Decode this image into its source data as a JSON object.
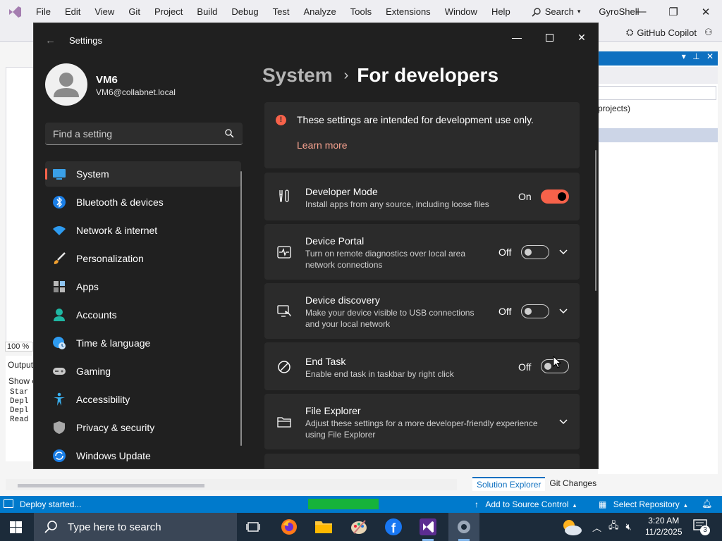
{
  "vs": {
    "menu": [
      "File",
      "Edit",
      "View",
      "Git",
      "Project",
      "Build",
      "Debug",
      "Test",
      "Analyze",
      "Tools",
      "Extensions",
      "Window",
      "Help"
    ],
    "search_label": "Search",
    "solution_name": "GyroShell",
    "copilot_label": "GitHub Copilot",
    "zoom": "100 %",
    "output_title": "Output",
    "output_show": "Show o",
    "output_lines": [
      "Star",
      "Depl",
      "Depl",
      "Read"
    ],
    "se_projects_text": "projects)",
    "tabs": [
      "Solution Explorer",
      "Git Changes"
    ],
    "status": {
      "text": "Deploy started...",
      "source_control": "Add to Source Control",
      "repository": "Select Repository"
    }
  },
  "taskbar": {
    "search_placeholder": "Type here to search",
    "time": "3:20 AM",
    "date": "11/2/2025",
    "notifications": "3",
    "apps": [
      "task-view",
      "firefox",
      "file-explorer",
      "paint",
      "facebook",
      "visual-studio",
      "settings"
    ]
  },
  "settings": {
    "app_title": "Settings",
    "user": {
      "name": "VM6",
      "email": "VM6@collabnet.local"
    },
    "search_placeholder": "Find a setting",
    "nav": [
      {
        "label": "System",
        "icon": "system-icon",
        "active": true
      },
      {
        "label": "Bluetooth & devices",
        "icon": "bluetooth-icon"
      },
      {
        "label": "Network & internet",
        "icon": "wifi-icon"
      },
      {
        "label": "Personalization",
        "icon": "brush-icon"
      },
      {
        "label": "Apps",
        "icon": "apps-icon"
      },
      {
        "label": "Accounts",
        "icon": "accounts-icon"
      },
      {
        "label": "Time & language",
        "icon": "globe-clock-icon"
      },
      {
        "label": "Gaming",
        "icon": "gamepad-icon"
      },
      {
        "label": "Accessibility",
        "icon": "accessibility-icon"
      },
      {
        "label": "Privacy & security",
        "icon": "shield-icon"
      },
      {
        "label": "Windows Update",
        "icon": "update-icon"
      }
    ],
    "breadcrumb": {
      "parent": "System",
      "separator": "›",
      "current": "For developers"
    },
    "info": {
      "text": "These settings are intended for development use only.",
      "link": "Learn more"
    },
    "items": [
      {
        "title": "Developer Mode",
        "desc": "Install apps from any source, including loose files",
        "state": "On",
        "on": true,
        "expandable": false
      },
      {
        "title": "Device Portal",
        "desc": "Turn on remote diagnostics over local area network connections",
        "state": "Off",
        "on": false,
        "expandable": true
      },
      {
        "title": "Device discovery",
        "desc": "Make your device visible to USB connections and your local network",
        "state": "Off",
        "on": false,
        "expandable": true
      },
      {
        "title": "End Task",
        "desc": "Enable end task in taskbar by right click",
        "state": "Off",
        "on": false,
        "expandable": false
      },
      {
        "title": "File Explorer",
        "desc": "Adjust these settings for a more developer-friendly experience using File Explorer",
        "expandable": true
      }
    ],
    "colors": {
      "accent": "#f7624a",
      "background": "#202020",
      "card": "#2b2b2b"
    }
  }
}
